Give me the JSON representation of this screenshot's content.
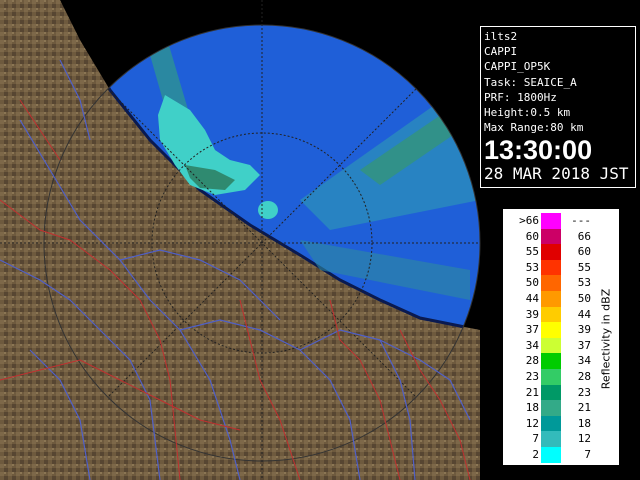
{
  "info": {
    "station": "ilts2",
    "product": "CAPPI",
    "product_id": "CAPPI_OP5K",
    "task": "Task: SEAICE_A",
    "prf": "PRF: 1800Hz",
    "height": "Height:0.5 km",
    "max_range": "Max Range:80 km",
    "time": "13:30:00",
    "date": "28 MAR 2018 JST"
  },
  "legend": {
    "title": "Reflectivity in dBZ",
    "rows": [
      {
        "lo": ">66",
        "hi": "---",
        "color": "#ff00ff"
      },
      {
        "lo": "60",
        "hi": "66",
        "color": "#cc0066"
      },
      {
        "lo": "55",
        "hi": "60",
        "color": "#e00000"
      },
      {
        "lo": "53",
        "hi": "55",
        "color": "#ff3300"
      },
      {
        "lo": "50",
        "hi": "53",
        "color": "#ff6600"
      },
      {
        "lo": "44",
        "hi": "50",
        "color": "#ff9900"
      },
      {
        "lo": "39",
        "hi": "44",
        "color": "#ffcc00"
      },
      {
        "lo": "37",
        "hi": "39",
        "color": "#ffff00"
      },
      {
        "lo": "34",
        "hi": "37",
        "color": "#ccff33"
      },
      {
        "lo": "28",
        "hi": "34",
        "color": "#00cc00"
      },
      {
        "lo": "23",
        "hi": "28",
        "color": "#33cc66"
      },
      {
        "lo": "21",
        "hi": "23",
        "color": "#009966"
      },
      {
        "lo": "18",
        "hi": "21",
        "color": "#33aa88"
      },
      {
        "lo": "12",
        "hi": "18",
        "color": "#009999"
      },
      {
        "lo": "7",
        "hi": "12",
        "color": "#33bbbb"
      },
      {
        "lo": "2",
        "hi": "7",
        "color": "#00ffff"
      }
    ]
  },
  "colors": {
    "land": "#6e5a3e",
    "land_dark": "#4e3e28",
    "sea_in_range": "#1f5fd8",
    "outside": "#000000",
    "echo": "#40e0d0",
    "rivers": "#5060c8",
    "boundaries": "#c03030"
  }
}
